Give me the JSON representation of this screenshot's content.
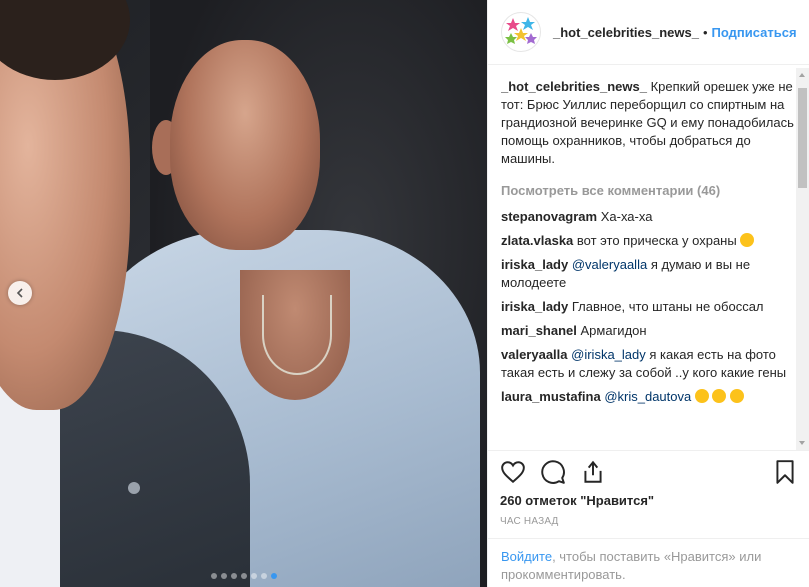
{
  "post": {
    "username": "_hot_celebrities_news_",
    "separator": "•",
    "follow_label": "Подписаться",
    "caption_user": "_hot_celebrities_news_",
    "caption_text": "Крепкий орешек уже не тот: Брюс Уиллис переборщил со спиртным на грандиозной вечеринке GQ и ему понадобилась помощь охранников, чтобы добраться до машины.",
    "view_all_comments": "Посмотреть все комментарии (46)",
    "comments": [
      {
        "user": "stepanovagram",
        "mention": "",
        "text": "Ха-ха-ха"
      },
      {
        "user": "zlata.vlaska",
        "mention": "",
        "text": "вот это прическа у охраны"
      },
      {
        "user": "iriska_lady",
        "mention": "@valeryaalla",
        "text": "я думаю и вы не молодеете"
      },
      {
        "user": "iriska_lady",
        "mention": "",
        "text": "Главное, что штаны не обоссал"
      },
      {
        "user": "mari_shanel",
        "mention": "",
        "text": "Армагидон"
      },
      {
        "user": "valeryaalla",
        "mention": "@iriska_lady",
        "text": "я какая есть на фото такая есть и слежу за собой ..у кого какие гены"
      },
      {
        "user": "laura_mustafina",
        "mention": "@kris_dautova",
        "text": ""
      }
    ],
    "likes": "260 отметок \"Нравится\"",
    "timestamp": "ЧАС НАЗАД",
    "login_link": "Войдите",
    "login_text": ", чтобы поставить «Нравится» или прокомментировать."
  },
  "carousel": {
    "total": 7,
    "active_index": 6
  },
  "colors": {
    "link": "#3897f0",
    "text": "#262626",
    "muted": "#999999"
  }
}
